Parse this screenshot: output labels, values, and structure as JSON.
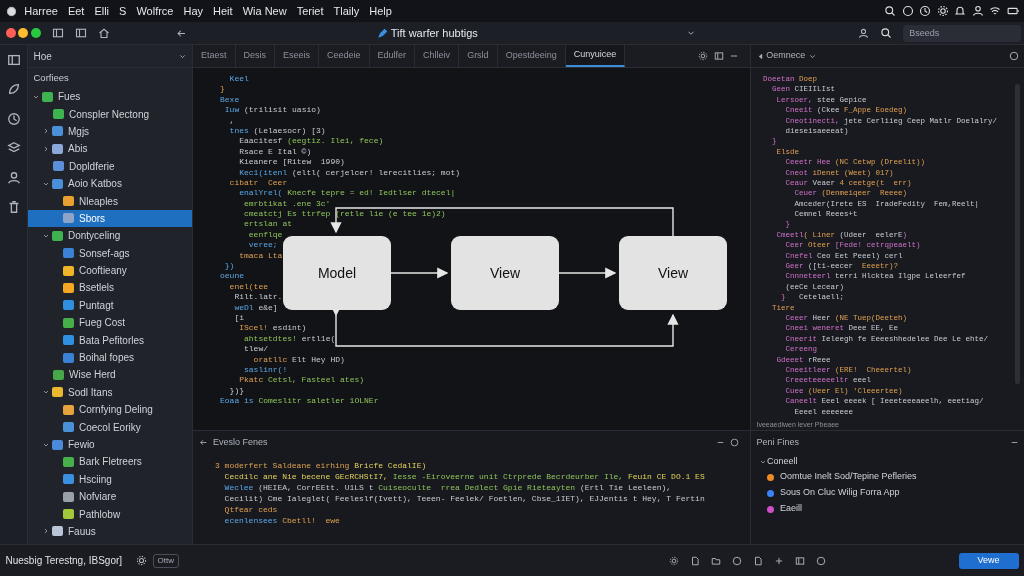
{
  "menu_bar": {
    "items": [
      "Harree",
      "Eet",
      "Elli",
      "S",
      "Wolfrce",
      "Hay",
      "Heit",
      "Wia New",
      "Teriet",
      "Tlaily",
      "Help"
    ]
  },
  "window": {
    "title": "Tift warfer hubtigs",
    "search": {
      "placeholder": "Bseeds"
    }
  },
  "sidebar": {
    "header": "Hoe",
    "section": "Corfiees",
    "tree": [
      {
        "label": "Fues",
        "color": "#3fb34f",
        "expanded": true,
        "selected": false,
        "children": [
          {
            "label": "Conspler Nectong",
            "color": "#3fb34f",
            "selected": false
          },
          {
            "label": "Mgjs",
            "color": "#4a90d9",
            "expanded": false,
            "selected": false
          },
          {
            "label": "Abis",
            "color": "#8aa8d8",
            "expanded": false,
            "selected": false
          },
          {
            "label": "Dopldferie",
            "color": "#5b8fd8",
            "selected": false
          },
          {
            "label": "Aoio Katbos",
            "color": "#4a90d9",
            "expanded": true,
            "selected": false,
            "children": [
              {
                "label": "Nleaples",
                "color": "#e8a030",
                "selected": false
              },
              {
                "label": "Sbors",
                "color": "#8da4c8",
                "selected": true
              }
            ]
          },
          {
            "label": "Dontyceling",
            "color": "#3fb34f",
            "expanded": true,
            "selected": false,
            "children": [
              {
                "label": "Sonsef-ags",
                "color": "#3b82d6",
                "selected": false
              },
              {
                "label": "Cooftieany",
                "color": "#f0b429",
                "selected": false
              },
              {
                "label": "Bsetlels",
                "color": "#f5a623",
                "selected": false
              },
              {
                "label": "Puntagt",
                "color": "#2f8fe0",
                "selected": false
              },
              {
                "label": "Fueg Cost",
                "color": "#45b04a",
                "selected": false
              },
              {
                "label": "Bata Pefitorles",
                "color": "#2f8fe0",
                "selected": false
              },
              {
                "label": "Boihal fopes",
                "color": "#3b82d6",
                "selected": false
              }
            ]
          },
          {
            "label": "Wise Herd",
            "color": "#47a84a",
            "selected": false
          },
          {
            "label": "Sodl Itans",
            "color": "#e8b830",
            "expanded": true,
            "selected": false,
            "children": [
              {
                "label": "Cornfying Deling",
                "color": "#e6a23c",
                "selected": false
              },
              {
                "label": "Coecol Eoriky",
                "color": "#4a90d9",
                "selected": false
              }
            ]
          },
          {
            "label": "Fewio",
            "color": "#4a8ad8",
            "expanded": true,
            "selected": false,
            "children": [
              {
                "label": "Bark Fletreers",
                "color": "#47b04d",
                "selected": false
              },
              {
                "label": "Hsciing",
                "color": "#3b8fe0",
                "selected": false
              },
              {
                "label": "Nofviare",
                "color": "#9aa0a8",
                "selected": false
              },
              {
                "label": "Pathlobw",
                "color": "#a3c93a",
                "selected": false
              }
            ]
          },
          {
            "label": "Fauus",
            "color": "#b8c6d8",
            "expanded": false,
            "selected": false
          }
        ]
      }
    ]
  },
  "editor": {
    "tabs": [
      {
        "label": "Etaest",
        "selected": false
      },
      {
        "label": "Desis",
        "selected": false
      },
      {
        "label": "Eseeis",
        "selected": false
      },
      {
        "label": "Ceedeie",
        "selected": false
      },
      {
        "label": "Edulfer",
        "selected": false
      },
      {
        "label": "Chlleiv",
        "selected": false
      },
      {
        "label": "Grsld",
        "selected": false
      },
      {
        "label": "Opestdeeing",
        "selected": false
      },
      {
        "label": "Cunyuicee",
        "selected": true
      }
    ],
    "lines": [
      [
        {
          "kind": "k",
          "text": "  Keel"
        }
      ],
      [
        {
          "kind": "o",
          "text": "}"
        }
      ],
      [
        {
          "kind": "k",
          "text": "Bexe"
        }
      ],
      [
        {
          "kind": "k",
          "text": " Iuw "
        },
        {
          "kind": "p",
          "text": "(trilisit uasio)"
        }
      ],
      [
        {
          "kind": "p",
          "text": "  ,"
        }
      ],
      [
        {
          "kind": "k",
          "text": "  tnes "
        },
        {
          "kind": "p",
          "text": "(Lelaesocr) [3)"
        }
      ],
      [
        {
          "kind": "p",
          "text": "    Eaacitesf "
        },
        {
          "kind": "s",
          "text": "(eegtiz. Ilei, fece)"
        }
      ],
      [
        {
          "kind": "p",
          "text": "    Rsace E Ital ©)"
        }
      ],
      [
        {
          "kind": "p",
          "text": "    Kieanere [Ritew  1990)"
        }
      ],
      [
        {
          "kind": "k",
          "text": "    Kec1(itenl "
        },
        {
          "kind": "p",
          "text": "(eltl( cerjelcer! lerecitlies; mot)"
        }
      ],
      [
        {
          "kind": "o",
          "text": "  cibatr  Ceer"
        }
      ],
      [
        {
          "kind": "k",
          "text": "    enalYrel( "
        },
        {
          "kind": "s",
          "text": "Knecfe tepre = ed! Iedtlser dtecel|"
        }
      ],
      [
        {
          "kind": "s",
          "text": "     emrbtikat .ene 3c'"
        }
      ],
      [
        {
          "kind": "s",
          "text": "     cmeatctj Es ttrfep (retle lie (e tee 1e)2)"
        }
      ],
      [
        {
          "kind": "s",
          "text": "     ertslan at"
        }
      ],
      [
        {
          "kind": "s",
          "text": "      eenflqe"
        }
      ],
      [
        {
          "kind": "k",
          "text": "      veree;"
        }
      ],
      [
        {
          "kind": "o",
          "text": "    tmaca Lta"
        }
      ],
      [
        {
          "kind": "k",
          "text": " })"
        }
      ],
      [
        {
          "kind": "k",
          "text": "oeune"
        }
      ],
      [
        {
          "kind": "o",
          "text": "  enel(tee"
        }
      ],
      [
        {
          "kind": "p",
          "text": "   Rilt.latr."
        }
      ],
      [
        {
          "kind": "k",
          "text": "   weDl "
        },
        {
          "kind": "p",
          "text": "e&e]"
        }
      ],
      [
        {
          "kind": "p",
          "text": "   [i"
        }
      ],
      [
        {
          "kind": "o",
          "text": "    IScel! "
        },
        {
          "kind": "p",
          "text": "esdint)"
        }
      ],
      [
        {
          "kind": "s",
          "text": "     ahtsetdtes! "
        },
        {
          "kind": "p",
          "text": "ertl1e("
        }
      ],
      [
        {
          "kind": "p",
          "text": "     tlew/"
        }
      ],
      [
        {
          "kind": "o",
          "text": "       oratllc "
        },
        {
          "kind": "p",
          "text": "Elt Hey HD)"
        }
      ],
      [
        {
          "kind": "k",
          "text": "     saslinr(!"
        }
      ],
      [
        {
          "kind": "o",
          "text": "    Pkatc "
        },
        {
          "kind": "s",
          "text": "Cetsl, Fasteel ates)"
        }
      ],
      [
        {
          "kind": "p",
          "text": "  })}"
        }
      ],
      [
        {
          "kind": "k",
          "text": "Eoaa is "
        },
        {
          "kind": "s",
          "text": "Comeslitr saletler 1OLNEr"
        }
      ]
    ]
  },
  "diagram": {
    "nodes": [
      {
        "label": "Model"
      },
      {
        "label": "View"
      },
      {
        "label": "View"
      }
    ]
  },
  "right_panel": {
    "title": "Oemnece",
    "status": "Iveeaedlwen lever Pbeaee",
    "lines": [
      [
        {
          "kind": "m",
          "text": "Doeetan "
        },
        {
          "kind": "o",
          "text": "Doep"
        }
      ],
      [
        {
          "kind": "m",
          "text": "  Geen "
        },
        {
          "kind": "p",
          "text": "CIEIILIst"
        }
      ],
      [
        {
          "kind": "m",
          "text": "   Lersoer, "
        },
        {
          "kind": "p",
          "text": "stee Gepice"
        }
      ],
      [
        {
          "kind": "m",
          "text": "     Cneeit "
        },
        {
          "kind": "p",
          "text": "(Ckee "
        },
        {
          "kind": "o",
          "text": "F_Appe Eoedeg)"
        }
      ],
      [
        {
          "kind": "m",
          "text": "     Cneotinecti, "
        },
        {
          "kind": "p",
          "text": "jete Cerliieg Ceep Matlr Doelalry/"
        }
      ],
      [
        {
          "kind": "p",
          "text": "     dieseisaeeeat)"
        }
      ],
      [
        {
          "kind": "m",
          "text": "  }"
        }
      ],
      [
        {
          "kind": "o",
          "text": "   Elsde"
        }
      ],
      [
        {
          "kind": "m",
          "text": "     Ceeetr Hee "
        },
        {
          "kind": "o",
          "text": "(NC Cetwp (Dreelit))"
        }
      ],
      [
        {
          "kind": "m",
          "text": "     Cneot "
        },
        {
          "kind": "o",
          "text": "iDenet (Weet) 017)"
        }
      ],
      [
        {
          "kind": "m",
          "text": "     Ceaur "
        },
        {
          "kind": "p",
          "text": "Veaer "
        },
        {
          "kind": "o",
          "text": "4 ceetge(t  err)"
        }
      ],
      [
        {
          "kind": "m",
          "text": "       Ceuer "
        },
        {
          "kind": "o",
          "text": "(Denmeiqeer  Reeee)"
        }
      ],
      [
        {
          "kind": "p",
          "text": "       Amceder(Irete ES  IradeFedity  Fem,Reelt|"
        }
      ],
      [
        {
          "kind": "p",
          "text": "       Cemnel Reees+t"
        }
      ],
      [
        {
          "kind": "m",
          "text": "     }"
        }
      ],
      [
        {
          "kind": "m",
          "text": "   Cmeetl"
        },
        {
          "kind": "o",
          "text": "( Liner "
        },
        {
          "kind": "p",
          "text": "(Udeer  eelerE"
        },
        {
          "kind": "m",
          "text": ")"
        }
      ],
      [
        {
          "kind": "m",
          "text": "     Ceer "
        },
        {
          "kind": "o",
          "text": "Oteer "
        },
        {
          "kind": "m",
          "text": "[Fede! cetrqpeaelt)"
        }
      ],
      [
        {
          "kind": "m",
          "text": "     Cnefel "
        },
        {
          "kind": "p",
          "text": "Ceo Eet Peeel) cerl"
        }
      ],
      [
        {
          "kind": "m",
          "text": "     Geer "
        },
        {
          "kind": "p",
          "text": "([ti-eecer  "
        },
        {
          "kind": "o",
          "text": "Eeeetr)?"
        }
      ],
      [
        {
          "kind": "m",
          "text": "     Cnnneteerl "
        },
        {
          "kind": "p",
          "text": "terri Hlcktea Ilgpe Leleerfef"
        }
      ],
      [
        {
          "kind": "p",
          "text": "     (eeCe Lecear)"
        }
      ],
      [
        {
          "kind": "m",
          "text": "    }   "
        },
        {
          "kind": "p",
          "text": "Cetelaell;"
        }
      ],
      [
        {
          "kind": "o",
          "text": "  Tiere"
        }
      ],
      [
        {
          "kind": "m",
          "text": "     Ceeer "
        },
        {
          "kind": "p",
          "text": "Heer "
        },
        {
          "kind": "o",
          "text": "(NE Tuep(Deeteh)"
        }
      ],
      [
        {
          "kind": "m",
          "text": "     Cneei weneret "
        },
        {
          "kind": "p",
          "text": "Deee EE, Ee"
        }
      ],
      [
        {
          "kind": "m",
          "text": "     Cneerit "
        },
        {
          "kind": "p",
          "text": "Ieleegh fe Eeeeshhedelee Dee Le ehte/"
        }
      ],
      [
        {
          "kind": "m",
          "text": "     Cereeng"
        }
      ],
      [
        {
          "kind": "m",
          "text": "   Gdeeet "
        },
        {
          "kind": "p",
          "text": "rReee"
        }
      ],
      [
        {
          "kind": "m",
          "text": "     Cneeitleer "
        },
        {
          "kind": "o",
          "text": "(ERE!  Cheeertel)"
        }
      ],
      [
        {
          "kind": "m",
          "text": "     Creeeteeeeeltr "
        },
        {
          "kind": "p",
          "text": "eeel"
        }
      ],
      [
        {
          "kind": "m",
          "text": "     Cuee "
        },
        {
          "kind": "o",
          "text": "(Ueer El) 'Cleeertee)"
        }
      ],
      [
        {
          "kind": "m",
          "text": "     Caneelt "
        },
        {
          "kind": "p",
          "text": "Eeel eeeek [ Ieeeteeeaeelh, eeetiag/"
        }
      ],
      [
        {
          "kind": "p",
          "text": "       Eeeel eeeeeee"
        }
      ]
    ]
  },
  "output_panel": {
    "title": "Eveslo Fenes",
    "lines": [
      [
        {
          "kind": "o",
          "text": "3 moderfert Saldeane eirhing "
        },
        {
          "kind": "y",
          "text": "Bricfe CedalIE)"
        }
      ],
      [
        {
          "kind": "y",
          "text": "  Cecdilc ane Nie becene GEcRCHStI7, "
        },
        {
          "kind": "s",
          "text": "Iesse -Eiroveerne unit Ctrprede Becrdeurber Ile, "
        },
        {
          "kind": "y",
          "text": "Feuin CE DO.1 ES"
        }
      ],
      [
        {
          "kind": "k",
          "text": "  Weclee "
        },
        {
          "kind": "p",
          "text": "(HEIEA, CorrEEtt. U1LS t "
        },
        {
          "kind": "s",
          "text": "Cuiseoculte  rrea Dedlect Gpie Rieteayten "
        },
        {
          "kind": "p",
          "text": "(Ertl Tie Leeleen),"
        }
      ],
      [
        {
          "kind": "p",
          "text": "  Cecilit) Cme Ialeglet( Feeleslf(Ivett), Teeen- Feelek/ Foetlen, Cbse_1IET), EJJentis t Hey, T Fertin"
        }
      ],
      [
        {
          "kind": "o",
          "text": "  Qtfear ceds"
        }
      ],
      [
        {
          "kind": "k",
          "text": "  ecenlensees "
        },
        {
          "kind": "o",
          "text": "Cbetll!  ewe"
        }
      ]
    ]
  },
  "files_panel": {
    "title": "Peni Fines",
    "group": "Coneell",
    "items": [
      {
        "label": "Oomtue Inelt Sod/Tepine Pefleries",
        "color": "#f08a24"
      },
      {
        "label": "Sous On Cluc Wilig Forra App",
        "color": "#3b82f6"
      },
      {
        "label": "Eaeill",
        "color": "#d04fc8"
      }
    ]
  },
  "status_bar": {
    "text": "Nuesbig Terestng, IBSgor]",
    "button": "Ottw",
    "primary_button": "Vewe"
  }
}
